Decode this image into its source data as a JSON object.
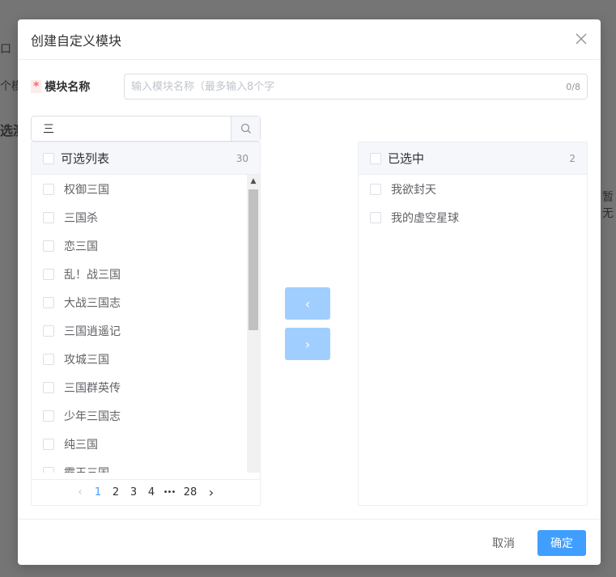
{
  "background": {
    "frag_1": "口",
    "frag_2": "个模",
    "frag_3": "选测",
    "frag_4": "暂无"
  },
  "modal": {
    "title": "创建自定义模块",
    "close_icon": "close-icon"
  },
  "form": {
    "required_mark": "*",
    "name_label": "模块名称",
    "name_placeholder": "输入模块名称（最多输入8个字",
    "name_counter": "0/8"
  },
  "search": {
    "value": "三",
    "icon": "search-icon"
  },
  "left_panel": {
    "title": "可选列表",
    "count": "30",
    "items": [
      {
        "label": "权御三国"
      },
      {
        "label": "三国杀"
      },
      {
        "label": "恋三国"
      },
      {
        "label": "乱！战三国"
      },
      {
        "label": "大战三国志"
      },
      {
        "label": "三国逍遥记"
      },
      {
        "label": "攻城三国"
      },
      {
        "label": "三国群英传"
      },
      {
        "label": "少年三国志"
      },
      {
        "label": "纯三国"
      },
      {
        "label": "霸王三国"
      }
    ],
    "pagination": {
      "prev_icon": "chevron-left-icon",
      "pages": [
        "1",
        "2",
        "3",
        "4"
      ],
      "current": "1",
      "ellipsis": "•••",
      "last": "28",
      "next_icon": "chevron-right-icon"
    }
  },
  "right_panel": {
    "title": "已选中",
    "count": "2",
    "items": [
      {
        "label": "我欲封天"
      },
      {
        "label": "我的虚空星球"
      }
    ]
  },
  "transfer": {
    "to_left": "‹",
    "to_right": "›"
  },
  "footer": {
    "cancel": "取消",
    "confirm": "确定"
  },
  "colors": {
    "primary": "#409eff",
    "primary_disabled": "#a0cfff",
    "required": "#f56c6c"
  }
}
